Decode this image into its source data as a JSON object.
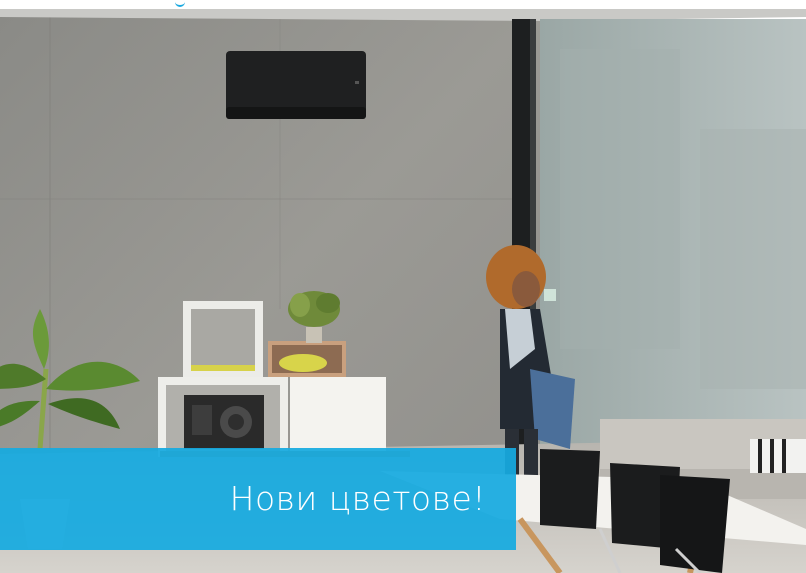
{
  "banner": {
    "text": "Нови цветове!",
    "background_color": "#16aae0",
    "text_color": "#ffffff"
  },
  "accent_color": "#1aa9e0",
  "scene_objects": [
    "air-conditioner",
    "woman-drinking",
    "shelving-units",
    "speaker",
    "potted-plant",
    "banana-plant",
    "dining-table",
    "black-chairs",
    "sofa",
    "glass-window"
  ]
}
